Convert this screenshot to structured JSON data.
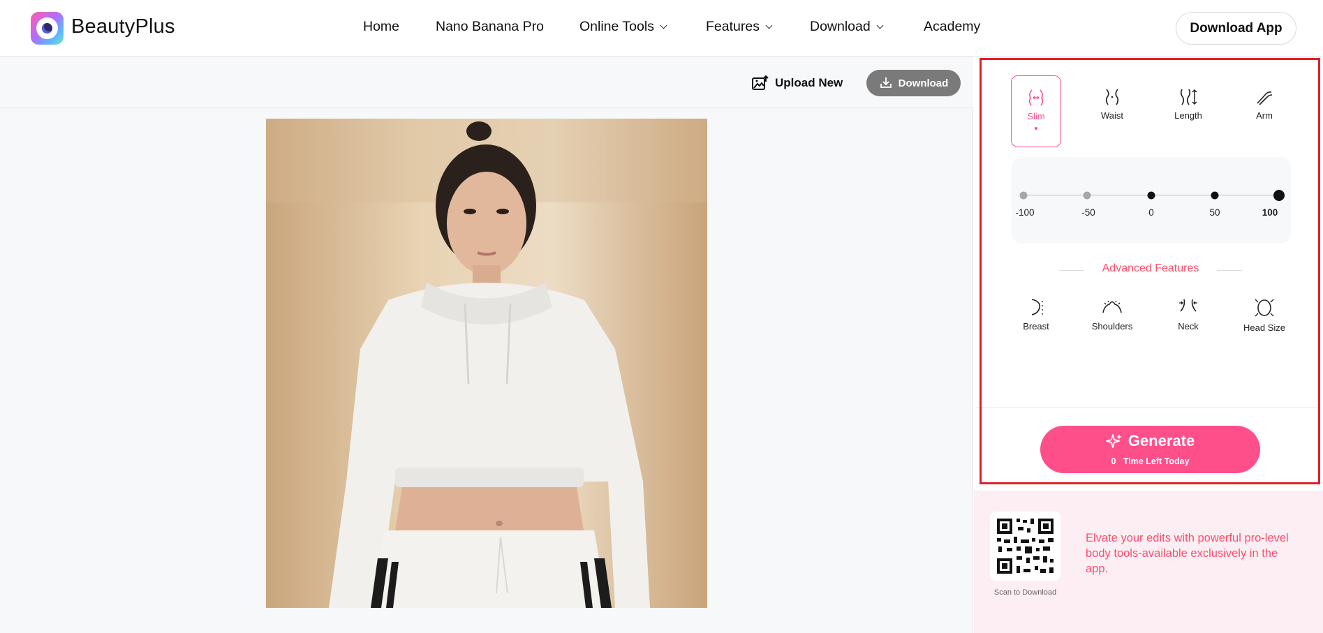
{
  "header": {
    "brand": "BeautyPlus",
    "nav": [
      {
        "label": "Home",
        "dropdown": false
      },
      {
        "label": "Nano Banana Pro",
        "dropdown": false
      },
      {
        "label": "Online Tools",
        "dropdown": true
      },
      {
        "label": "Features",
        "dropdown": true
      },
      {
        "label": "Download",
        "dropdown": true
      },
      {
        "label": "Academy",
        "dropdown": false
      }
    ],
    "download_app": "Download App"
  },
  "toolbar": {
    "upload_new": "Upload New",
    "download": "Download"
  },
  "body_tools": [
    {
      "label": "Slim",
      "icon": "slim-body-icon",
      "active": true
    },
    {
      "label": "Waist",
      "icon": "waist-icon",
      "active": false
    },
    {
      "label": "Length",
      "icon": "length-icon",
      "active": false
    },
    {
      "label": "Arm",
      "icon": "arm-icon",
      "active": false
    }
  ],
  "slider": {
    "ticks": [
      "-100",
      "-50",
      "0",
      "50",
      "100"
    ],
    "current": "100"
  },
  "advanced": {
    "title": "Advanced Features",
    "tools": [
      {
        "label": "Breast",
        "icon": "breast-icon"
      },
      {
        "label": "Shoulders",
        "icon": "shoulders-icon"
      },
      {
        "label": "Neck",
        "icon": "neck-icon"
      },
      {
        "label": "Head Size",
        "icon": "head-size-icon"
      }
    ]
  },
  "generate": {
    "label": "Generate",
    "remaining_count": "0",
    "remaining_suffix": "Time Left Today"
  },
  "promo": {
    "scan_label": "Scan to Download",
    "text": "Elvate your edits with powerful pro-level body tools-available exclusively in the app."
  },
  "colors": {
    "accent": "#ff4f8b",
    "highlight_border": "#e11f2a",
    "download_button": "#7a7a7a",
    "promo_bg": "#fdeef3"
  }
}
